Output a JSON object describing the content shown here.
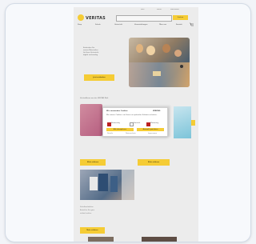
{
  "site": {
    "brand": "VERITAS",
    "search_button": "Suchen",
    "top_links": [
      "Hilfe",
      "Konto",
      "Warenkorb"
    ],
    "menu": [
      "Shop",
      "Schule",
      "Unterricht",
      "Veranstaltungen",
      "Über uns",
      "Kontakt"
    ],
    "hero_lines": [
      "Entdecken Sie",
      "unsere Materialien",
      "für Ihren Unterricht",
      "digital und analog"
    ],
    "hero_button": "Jetzt entdecken",
    "section_title": "VeritasNeues aus der VERITAS Welt",
    "card_links": [
      "Mehr erfahren",
      "Mehr erfahren"
    ],
    "office_text": [
      "Schulbuchaktion",
      "Bestellen Sie ganz",
      "einfach online."
    ],
    "office_button": "Mehr erfahren"
  },
  "modal": {
    "title": "Wir verwenden Cookies",
    "logo": "VERITAS",
    "text": "Wir nutzen Cookies, um Ihnen ein optimales Erlebnis zu bieten.",
    "options": [
      "Notwendig",
      "Statistik",
      "Marketing"
    ],
    "accept_all": "Alle akzeptieren",
    "save": "Auswahl speichern",
    "links": [
      "Details",
      "Datenschutz",
      "Impressum"
    ]
  },
  "colors": {
    "accent": "#f5cc35",
    "background": "#f2f4f8",
    "card_border": "#d3dbe6"
  }
}
